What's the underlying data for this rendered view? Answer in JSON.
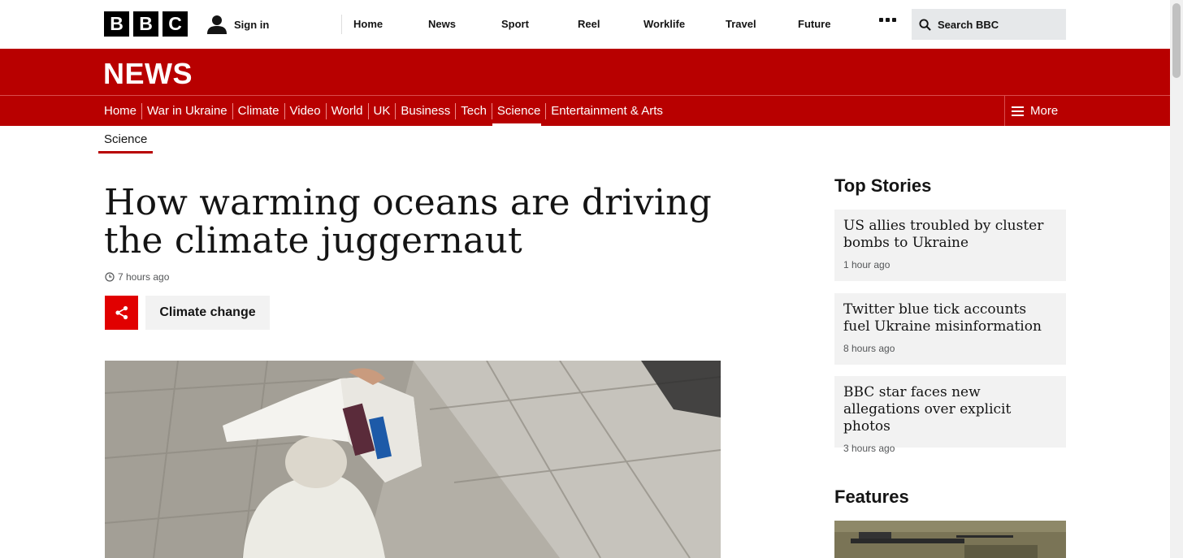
{
  "brand": {
    "logo_letters": [
      "B",
      "B",
      "C"
    ],
    "news_wordmark": "NEWS",
    "accent_color": "#b80000",
    "share_color": "#e10000"
  },
  "account": {
    "sign_in_label": "Sign in"
  },
  "top_nav": {
    "items": [
      "Home",
      "News",
      "Sport",
      "Reel",
      "Worklife",
      "Travel",
      "Future"
    ],
    "more_icon": "more-dots-icon"
  },
  "search": {
    "placeholder": "Search BBC"
  },
  "section_nav": {
    "items": [
      "Home",
      "War in Ukraine",
      "Climate",
      "Video",
      "World",
      "UK",
      "Business",
      "Tech",
      "Science",
      "Entertainment & Arts"
    ],
    "active": "Science",
    "more_label": "More"
  },
  "sub_nav": {
    "label": "Science"
  },
  "article": {
    "headline": "How warming oceans are driving the climate juggernaut",
    "timestamp": "7 hours ago",
    "topic_tag": "Climate change"
  },
  "sidebar": {
    "top_stories_heading": "Top Stories",
    "stories": [
      {
        "title": "US allies troubled by cluster bombs to Ukraine",
        "ago": "1 hour ago"
      },
      {
        "title": "Twitter blue tick accounts fuel Ukraine misinformation",
        "ago": "8 hours ago"
      },
      {
        "title": "BBC star faces new allegations over explicit photos",
        "ago": "3 hours ago"
      }
    ],
    "features_heading": "Features"
  }
}
